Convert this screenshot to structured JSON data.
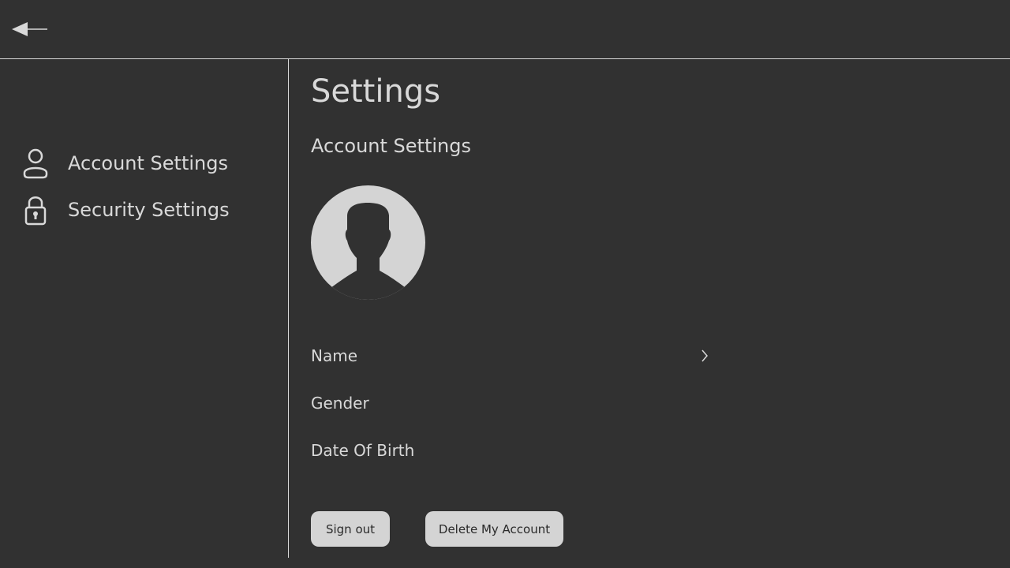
{
  "header": {
    "back_icon": "back-arrow-icon"
  },
  "sidebar": {
    "items": [
      {
        "label": "Account Settings",
        "icon": "user-icon"
      },
      {
        "label": "Security Settings",
        "icon": "lock-icon"
      }
    ]
  },
  "main": {
    "title": "Settings",
    "section_title": "Account Settings",
    "avatar_icon": "avatar-placeholder",
    "fields": [
      {
        "label": "Name",
        "has_chevron": true
      },
      {
        "label": "Gender",
        "has_chevron": false
      },
      {
        "label": "Date Of Birth",
        "has_chevron": false
      }
    ],
    "buttons": {
      "sign_out": "Sign out",
      "delete_account": "Delete My Account"
    }
  },
  "colors": {
    "background": "#313131",
    "foreground": "#d9d9d9",
    "button_bg": "#d4d4d4",
    "button_text": "#2a2a2a"
  }
}
